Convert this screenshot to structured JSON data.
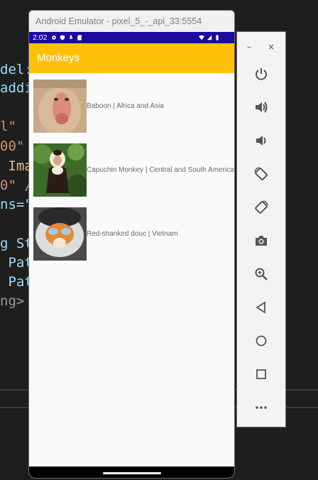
{
  "editor": {
    "lines": [
      {
        "segments": [
          {
            "t": "del:",
            "c": "c-blue"
          }
        ]
      },
      {
        "segments": [
          {
            "t": "addi",
            "c": "c-blue"
          }
        ]
      },
      {
        "segments": [
          {
            "t": "l\"",
            "c": "c-orange"
          }
        ]
      },
      {
        "segments": [
          {
            "t": "00\"",
            "c": "c-orange"
          }
        ]
      },
      {
        "segments": [
          {
            "t": " Ima",
            "c": "c-gold"
          }
        ]
      },
      {
        "segments": [
          {
            "t": "0\" /",
            "c": "c-orange"
          }
        ]
      },
      {
        "segments": [
          {
            "t": "ns=\"",
            "c": "c-blue"
          }
        ]
      },
      {
        "segments": [
          {
            "t": "g St",
            "c": "c-blue"
          }
        ]
      },
      {
        "segments": [
          {
            "t": " Pat",
            "c": "c-blue"
          }
        ]
      },
      {
        "segments": [
          {
            "t": " Pat",
            "c": "c-blue"
          }
        ]
      },
      {
        "segments": [
          {
            "t": "ng>",
            "c": "c-gray"
          }
        ]
      }
    ]
  },
  "emulator": {
    "window_title": "Android Emulator - pixel_5_-_api_33:5554",
    "status_time": "2:02",
    "app_title": "Monkeys",
    "items": [
      {
        "text": "Baboon | Africa and Asia",
        "image": "baboon"
      },
      {
        "text": "Capuchin Monkey | Central and South America",
        "image": "capuchin"
      },
      {
        "text": "Red-shanked douc | Vietnam",
        "image": "douc"
      }
    ]
  },
  "toolbar": {
    "minimize_glyph": "–",
    "close_glyph": "×",
    "buttons": [
      {
        "name": "power-icon"
      },
      {
        "name": "volume-up-icon"
      },
      {
        "name": "volume-down-icon"
      },
      {
        "name": "rotate-left-icon"
      },
      {
        "name": "rotate-right-icon"
      },
      {
        "name": "camera-icon"
      },
      {
        "name": "zoom-icon"
      },
      {
        "name": "back-icon"
      },
      {
        "name": "home-icon"
      },
      {
        "name": "overview-icon"
      },
      {
        "name": "more-icon"
      }
    ]
  },
  "colors": {
    "app_bar": "#ffc107",
    "status_bar": "#1a0aa0",
    "editor_bg": "#1e1e1e"
  }
}
